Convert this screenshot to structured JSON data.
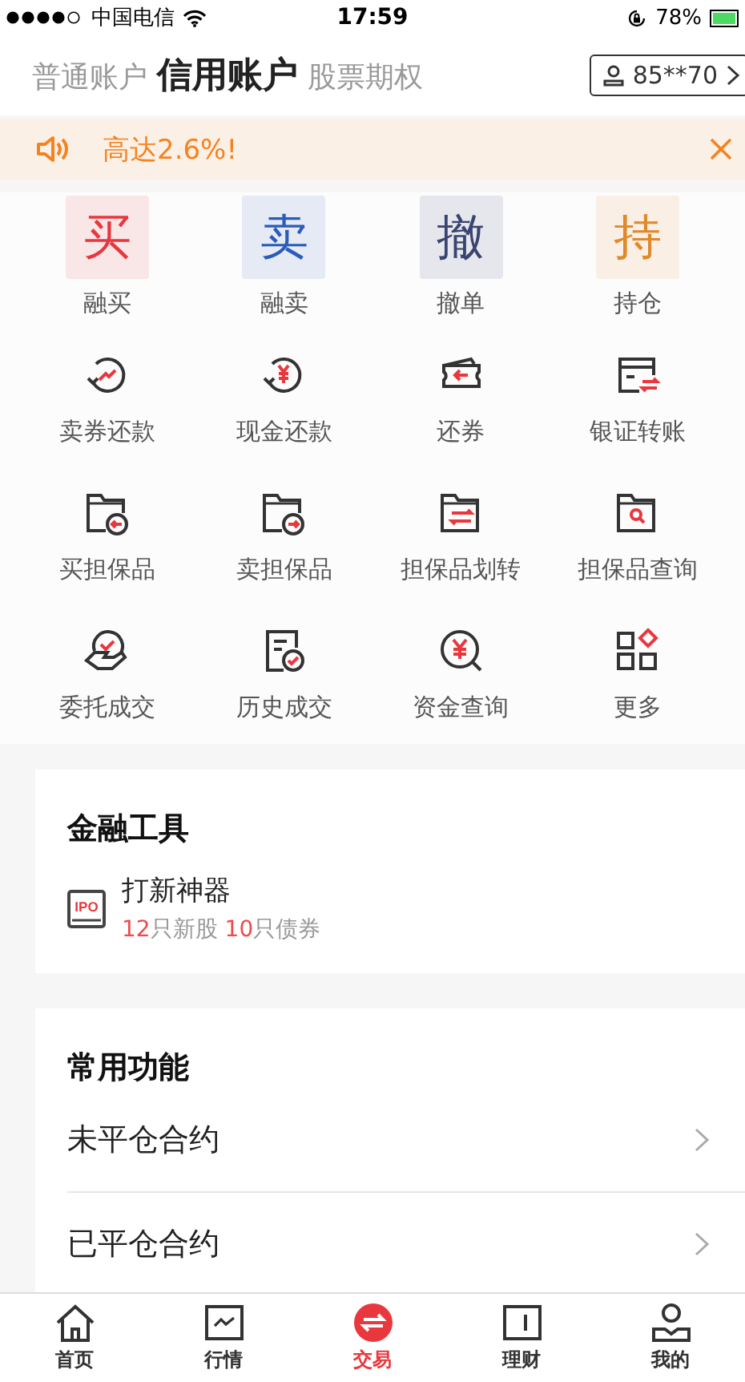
{
  "status_bar": {
    "carrier": "中国电信",
    "time": "17:59",
    "battery": "78%"
  },
  "account_tabs": [
    {
      "label": "普通账户",
      "selected": false
    },
    {
      "label": "信用账户",
      "selected": true
    },
    {
      "label": "股票期权",
      "selected": false
    }
  ],
  "account_button": {
    "label": "85**70"
  },
  "banner": {
    "text": "高达2.6%!"
  },
  "functions": [
    {
      "kind": "tile",
      "glyph": "买",
      "label": "融买",
      "color": "#e8383d"
    },
    {
      "kind": "tile",
      "glyph": "卖",
      "label": "融卖",
      "color": "#2a5cb8"
    },
    {
      "kind": "tile",
      "glyph": "撤",
      "label": "撤单",
      "color": "#3a4470"
    },
    {
      "kind": "tile",
      "glyph": "持",
      "label": "持仓",
      "color": "#e0892a"
    },
    {
      "kind": "icon",
      "label": "卖券还款"
    },
    {
      "kind": "icon",
      "label": "现金还款"
    },
    {
      "kind": "icon",
      "label": "还券"
    },
    {
      "kind": "icon",
      "label": "银证转账"
    },
    {
      "kind": "icon",
      "label": "买担保品"
    },
    {
      "kind": "icon",
      "label": "卖担保品"
    },
    {
      "kind": "icon",
      "label": "担保品划转"
    },
    {
      "kind": "icon",
      "label": "担保品查询"
    },
    {
      "kind": "icon",
      "label": "委托成交"
    },
    {
      "kind": "icon",
      "label": "历史成交"
    },
    {
      "kind": "icon",
      "label": "资金查询"
    },
    {
      "kind": "icon",
      "label": "更多"
    }
  ],
  "finance_tools": {
    "title": "金融工具",
    "item": {
      "icon_text": "IPO",
      "name": "打新神器",
      "counts": [
        {
          "number": "12",
          "unit": "只新股"
        },
        {
          "number": "10",
          "unit": "只债券"
        }
      ]
    }
  },
  "common_functions": {
    "title": "常用功能",
    "items": [
      "未平仓合约",
      "已平仓合约"
    ]
  },
  "tab_bar": [
    {
      "label": "首页",
      "selected": false
    },
    {
      "label": "行情",
      "selected": false
    },
    {
      "label": "交易",
      "selected": true
    },
    {
      "label": "理财",
      "selected": false
    },
    {
      "label": "我的",
      "selected": false
    }
  ]
}
